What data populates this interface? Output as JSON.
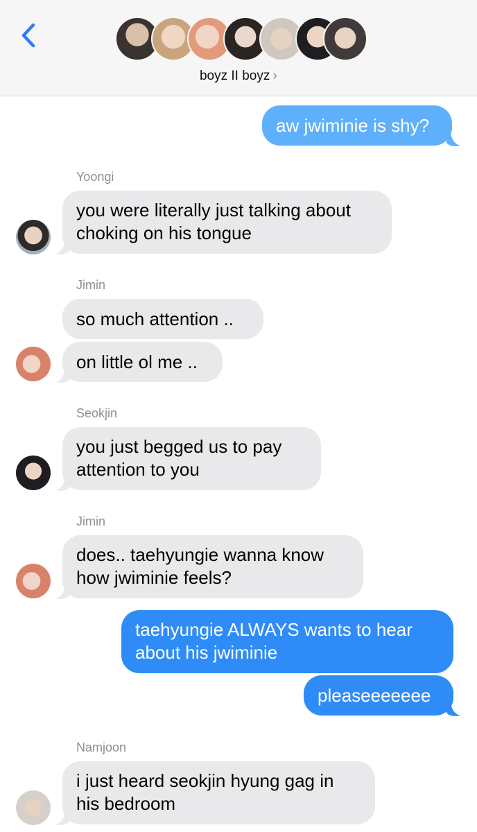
{
  "header": {
    "group_name": "boyz II boyz",
    "chevron": "›"
  },
  "colors": {
    "sent": "#2f8cf7",
    "sent_light": "#5fb0fa",
    "received": "#e9e9eb",
    "back": "#2f7bf6"
  },
  "messages": [
    {
      "side": "sent",
      "text": "aw jwiminie is shy?"
    },
    {
      "sender": "Yoongi",
      "side": "received",
      "text": "you were literally just talking about choking on his tongue"
    },
    {
      "sender": "Jimin",
      "side": "received",
      "text": "so much attention .."
    },
    {
      "side": "received",
      "text": "on little ol me .."
    },
    {
      "sender": "Seokjin",
      "side": "received",
      "text": "you just begged us to pay attention to you"
    },
    {
      "sender": "Jimin",
      "side": "received",
      "text": "does.. taehyungie wanna know how jwiminie feels?"
    },
    {
      "side": "sent",
      "text": "taehyungie ALWAYS wants to hear about his jwiminie"
    },
    {
      "side": "sent",
      "text": "pleaseeeeeee"
    },
    {
      "sender": "Namjoon",
      "side": "received",
      "text": "i just heard seokjin hyung gag in his bedroom"
    }
  ]
}
